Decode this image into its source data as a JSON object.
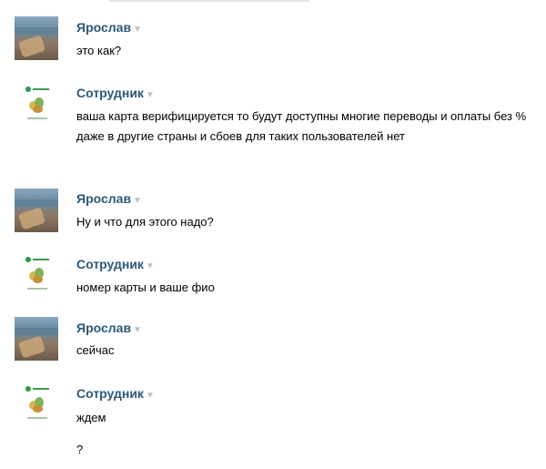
{
  "messages": [
    {
      "author": "Ярослав",
      "text": "это как?",
      "avatar": "user"
    },
    {
      "author": "Сотрудник",
      "text": "ваша карта верифицируется то будут доступны многие переводы и оплаты без % даже в другие страны и сбоев для таких пользователей нет",
      "avatar": "bank"
    },
    {
      "author": "Ярослав",
      "text": "Ну и что для этого надо?",
      "avatar": "user"
    },
    {
      "author": "Сотрудник",
      "text": "номер карты и ваше фио",
      "avatar": "bank"
    },
    {
      "author": "Ярослав",
      "text": "сейчас",
      "avatar": "user"
    },
    {
      "author": "Сотрудник",
      "text": "ждем",
      "avatar": "bank"
    }
  ],
  "extra_line": "?",
  "arrow_glyph": "▼",
  "colors": {
    "author": "#2b587a",
    "arrow": "#b7c2cc",
    "bank_green": "#2f9a44"
  }
}
